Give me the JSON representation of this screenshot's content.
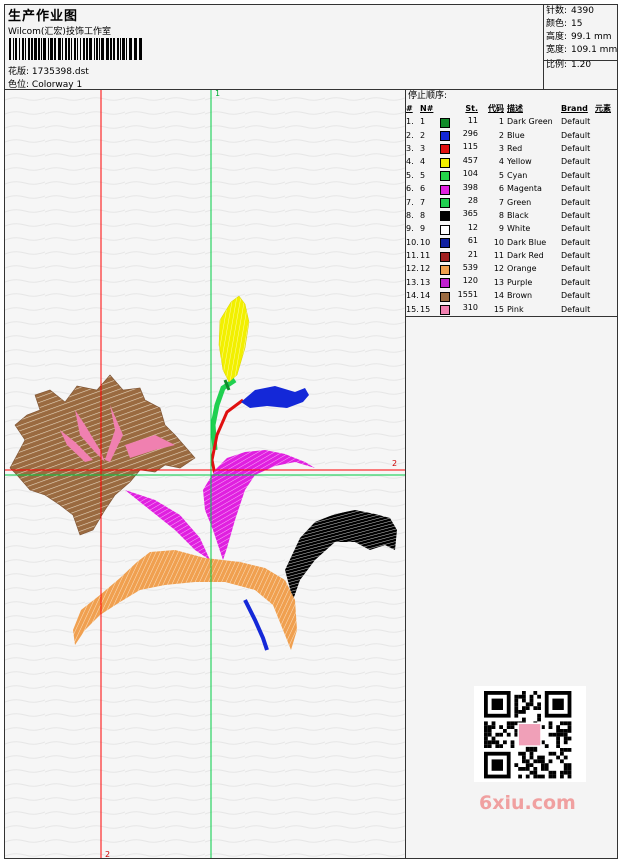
{
  "header": {
    "title": "生产作业图",
    "company": "Wilcom(汇宏)技饰工作室",
    "design_label": "花版:",
    "design_value": "1735398.dst",
    "colorway_label": "色位:",
    "colorway_value": "Colorway 1"
  },
  "stats": {
    "stitches_label": "针数:",
    "stitches_value": "4390",
    "colors_label": "颜色:",
    "colors_value": "15",
    "height_label": "高度:",
    "height_value": "99.1 mm",
    "width_label": "宽度:",
    "width_value": "109.1 mm",
    "scale_label": "比例:",
    "scale_value": "1.20"
  },
  "axes": {
    "vertical_top": "1",
    "vertical_bottom": "2",
    "horizontal_right": "2"
  },
  "stop_sequence": {
    "title": "停止顺序:",
    "columns": [
      "#",
      "N#",
      "St.",
      "代码",
      "描述",
      "Brand",
      "元素"
    ],
    "rows": [
      {
        "idx": "1.",
        "n": "1",
        "st": "11",
        "code": "1",
        "desc": "Dark Green",
        "brand": "Default",
        "color": "#118a2a"
      },
      {
        "idx": "2.",
        "n": "2",
        "st": "296",
        "code": "2",
        "desc": "Blue",
        "brand": "Default",
        "color": "#1428d8"
      },
      {
        "idx": "3.",
        "n": "3",
        "st": "115",
        "code": "3",
        "desc": "Red",
        "brand": "Default",
        "color": "#e01010"
      },
      {
        "idx": "4.",
        "n": "4",
        "st": "457",
        "code": "4",
        "desc": "Yellow",
        "brand": "Default",
        "color": "#f2f000"
      },
      {
        "idx": "5.",
        "n": "5",
        "st": "104",
        "code": "5",
        "desc": "Cyan",
        "brand": "Default",
        "color": "#24d64a"
      },
      {
        "idx": "6.",
        "n": "6",
        "st": "398",
        "code": "6",
        "desc": "Magenta",
        "brand": "Default",
        "color": "#e020e0"
      },
      {
        "idx": "7.",
        "n": "7",
        "st": "28",
        "code": "7",
        "desc": "Green",
        "brand": "Default",
        "color": "#20d050"
      },
      {
        "idx": "8.",
        "n": "8",
        "st": "365",
        "code": "8",
        "desc": "Black",
        "brand": "Default",
        "color": "#000000"
      },
      {
        "idx": "9.",
        "n": "9",
        "st": "12",
        "code": "9",
        "desc": "White",
        "brand": "Default",
        "color": "#ffffff"
      },
      {
        "idx": "10.",
        "n": "10",
        "st": "61",
        "code": "10",
        "desc": "Dark Blue",
        "brand": "Default",
        "color": "#1020a0"
      },
      {
        "idx": "11.",
        "n": "11",
        "st": "21",
        "code": "11",
        "desc": "Dark Red",
        "brand": "Default",
        "color": "#a02020"
      },
      {
        "idx": "12.",
        "n": "12",
        "st": "539",
        "code": "12",
        "desc": "Orange",
        "brand": "Default",
        "color": "#f0a050"
      },
      {
        "idx": "13.",
        "n": "13",
        "st": "120",
        "code": "13",
        "desc": "Purple",
        "brand": "Default",
        "color": "#c020d0"
      },
      {
        "idx": "14.",
        "n": "14",
        "st": "1551",
        "code": "14",
        "desc": "Brown",
        "brand": "Default",
        "color": "#9a6a40"
      },
      {
        "idx": "15.",
        "n": "15",
        "st": "310",
        "code": "15",
        "desc": "Pink",
        "brand": "Default",
        "color": "#f080b0"
      }
    ]
  },
  "watermark": "6xiu.com",
  "colors": {
    "axis_red": "#ff0000",
    "axis_green": "#00cc44",
    "border": "#333333"
  }
}
